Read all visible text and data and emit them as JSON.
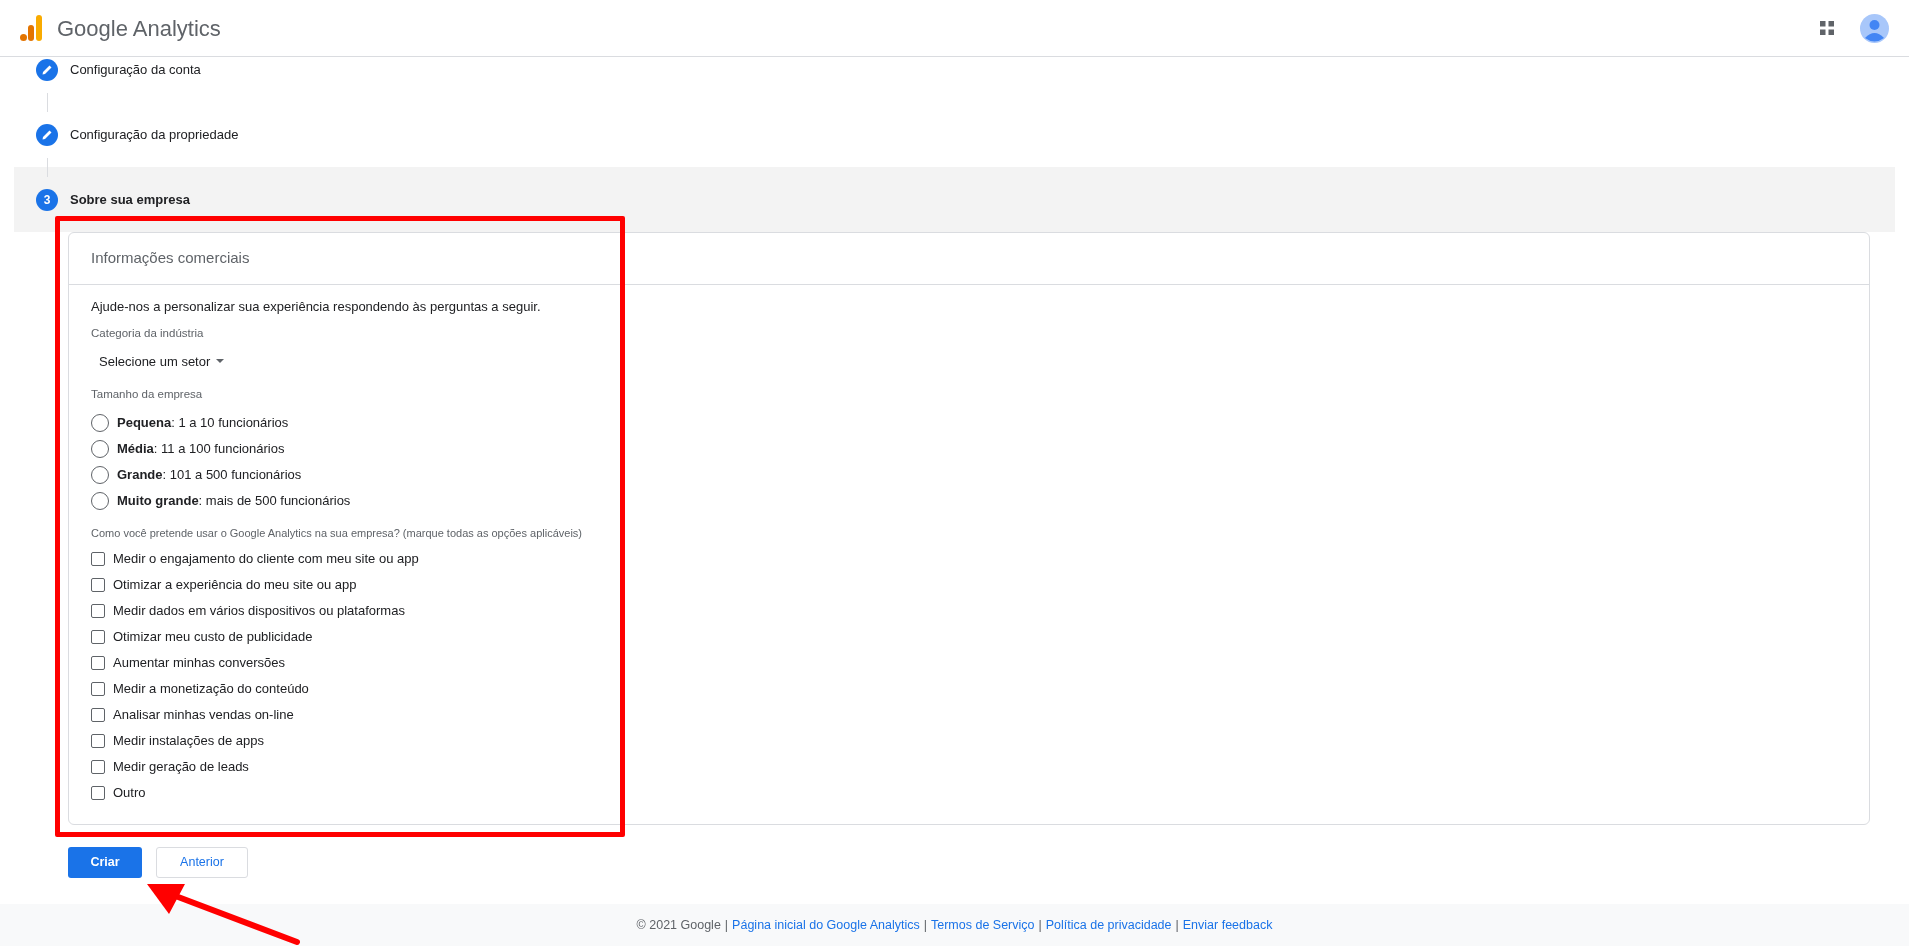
{
  "header": {
    "title": "Google Analytics"
  },
  "steps": [
    {
      "label": "Configuração da conta",
      "kind": "done"
    },
    {
      "label": "Configuração da propriedade",
      "kind": "done"
    },
    {
      "label": "Sobre sua empresa",
      "kind": "current",
      "number": "3"
    }
  ],
  "card": {
    "title": "Informações comerciais",
    "intro": "Ajude-nos a personalizar sua experiência respondendo às perguntas a seguir.",
    "industry": {
      "label": "Categoria da indústria",
      "value": "Selecione um setor"
    },
    "size": {
      "label": "Tamanho da empresa",
      "options": [
        {
          "text": "**Pequena**: 1 a 10 funcionários",
          "selected": false
        },
        {
          "text": "**Média**: 11 a 100 funcionários",
          "selected": false
        },
        {
          "text": "**Grande**: 101 a 500 funcionários",
          "selected": false
        },
        {
          "text": "**Muito grande**: mais de 500 funcionários",
          "selected": false
        }
      ]
    },
    "usage": {
      "label": "Como você pretende usar o Google Analytics na sua empresa? (marque todas as opções aplicáveis)",
      "options": [
        {
          "text": "Medir o engajamento do cliente com meu site ou app",
          "checked": false
        },
        {
          "text": "Otimizar a experiência do meu site ou app",
          "checked": false
        },
        {
          "text": "Medir dados em vários dispositivos ou plataformas",
          "checked": false
        },
        {
          "text": "Otimizar meu custo de publicidade",
          "checked": false
        },
        {
          "text": "Aumentar minhas conversões",
          "checked": false
        },
        {
          "text": "Medir a monetização do conteúdo",
          "checked": false
        },
        {
          "text": "Analisar minhas vendas on-line",
          "checked": false
        },
        {
          "text": "Medir instalações de apps",
          "checked": false
        },
        {
          "text": "Medir geração de leads",
          "checked": false
        },
        {
          "text": "Outro",
          "checked": false
        }
      ]
    }
  },
  "buttons": [
    {
      "label": "Criar",
      "kind": "primary"
    },
    {
      "label": "Anterior",
      "kind": "secondary"
    }
  ],
  "footer": {
    "copyright": "© 2021 Google",
    "separator": "|",
    "links": [
      "Página inicial do Google Analytics",
      "Termos de Serviço",
      "Política de privacidade",
      "Enviar feedback"
    ]
  }
}
